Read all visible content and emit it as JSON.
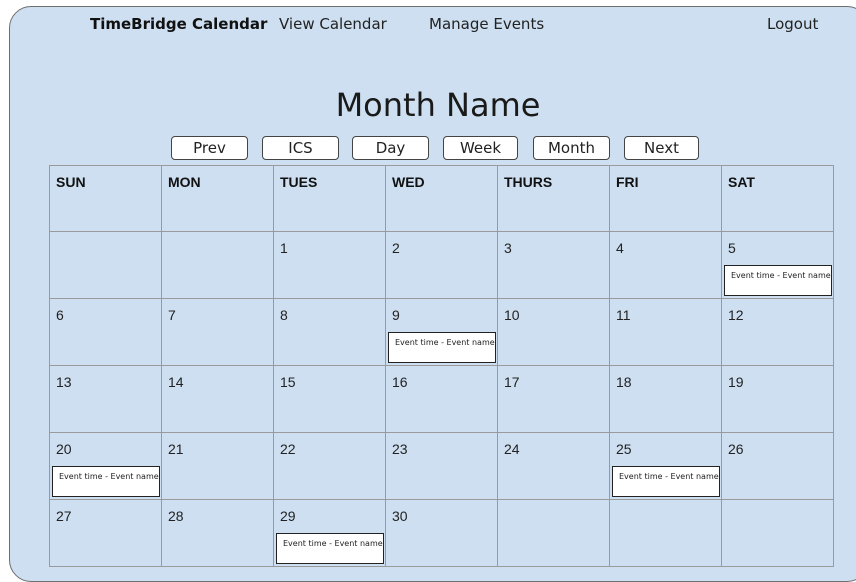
{
  "nav": {
    "brand": "TimeBridge Calendar",
    "view_calendar": "View Calendar",
    "manage_events": "Manage Events",
    "logout": "Logout"
  },
  "calendar": {
    "month_title": "Month Name",
    "buttons": {
      "prev": "Prev",
      "ics": "ICS",
      "day": "Day",
      "week": "Week",
      "month": "Month",
      "next": "Next"
    },
    "weekdays": [
      "SUN",
      "MON",
      "TUES",
      "WED",
      "THURS",
      "FRI",
      "SAT"
    ],
    "weeks": [
      [
        {
          "day": ""
        },
        {
          "day": ""
        },
        {
          "day": "1"
        },
        {
          "day": "2"
        },
        {
          "day": "3"
        },
        {
          "day": "4"
        },
        {
          "day": "5",
          "event": "Event time - Event name"
        }
      ],
      [
        {
          "day": "6"
        },
        {
          "day": "7"
        },
        {
          "day": "8"
        },
        {
          "day": "9",
          "event": "Event time - Event name"
        },
        {
          "day": "10"
        },
        {
          "day": "11"
        },
        {
          "day": "12"
        }
      ],
      [
        {
          "day": "13"
        },
        {
          "day": "14"
        },
        {
          "day": "15"
        },
        {
          "day": "16"
        },
        {
          "day": "17"
        },
        {
          "day": "18"
        },
        {
          "day": "19"
        }
      ],
      [
        {
          "day": "20",
          "event": "Event time - Event name"
        },
        {
          "day": "21"
        },
        {
          "day": "22"
        },
        {
          "day": "23"
        },
        {
          "day": "24"
        },
        {
          "day": "25",
          "event": "Event time - Event name"
        },
        {
          "day": "26"
        }
      ],
      [
        {
          "day": "27"
        },
        {
          "day": "28"
        },
        {
          "day": "29",
          "event": "Event time - Event name"
        },
        {
          "day": "30"
        },
        {
          "day": ""
        },
        {
          "day": ""
        },
        {
          "day": ""
        }
      ]
    ]
  }
}
